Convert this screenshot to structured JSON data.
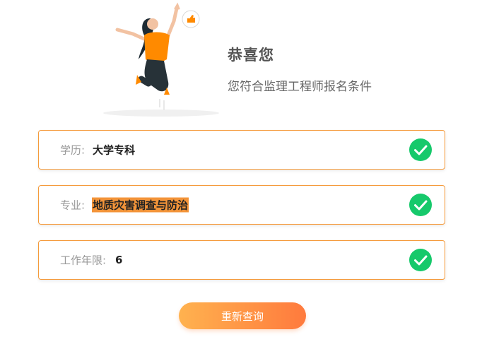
{
  "result": {
    "title": "恭喜您",
    "subtitle": "您符合监理工程师报名条件"
  },
  "criteria": [
    {
      "label": "学历:",
      "value": "大学专科",
      "highlight": false,
      "status_icon": "check-circle-icon",
      "status_color": "#16c96b"
    },
    {
      "label": "专业:",
      "value": "地质灾害调查与防治",
      "highlight": true,
      "highlight_color": "#f39439",
      "status_icon": "check-circle-icon",
      "status_color": "#16c96b"
    },
    {
      "label": "工作年限:",
      "value": "6",
      "highlight": false,
      "status_icon": "check-circle-icon",
      "status_color": "#16c96b"
    }
  ],
  "actions": {
    "requery_label": "重新查询"
  },
  "colors": {
    "accent_orange": "#f59a3b",
    "button_gradient_start": "#ffb24f",
    "button_gradient_end": "#ff7a3d",
    "success_green": "#16c96b"
  }
}
